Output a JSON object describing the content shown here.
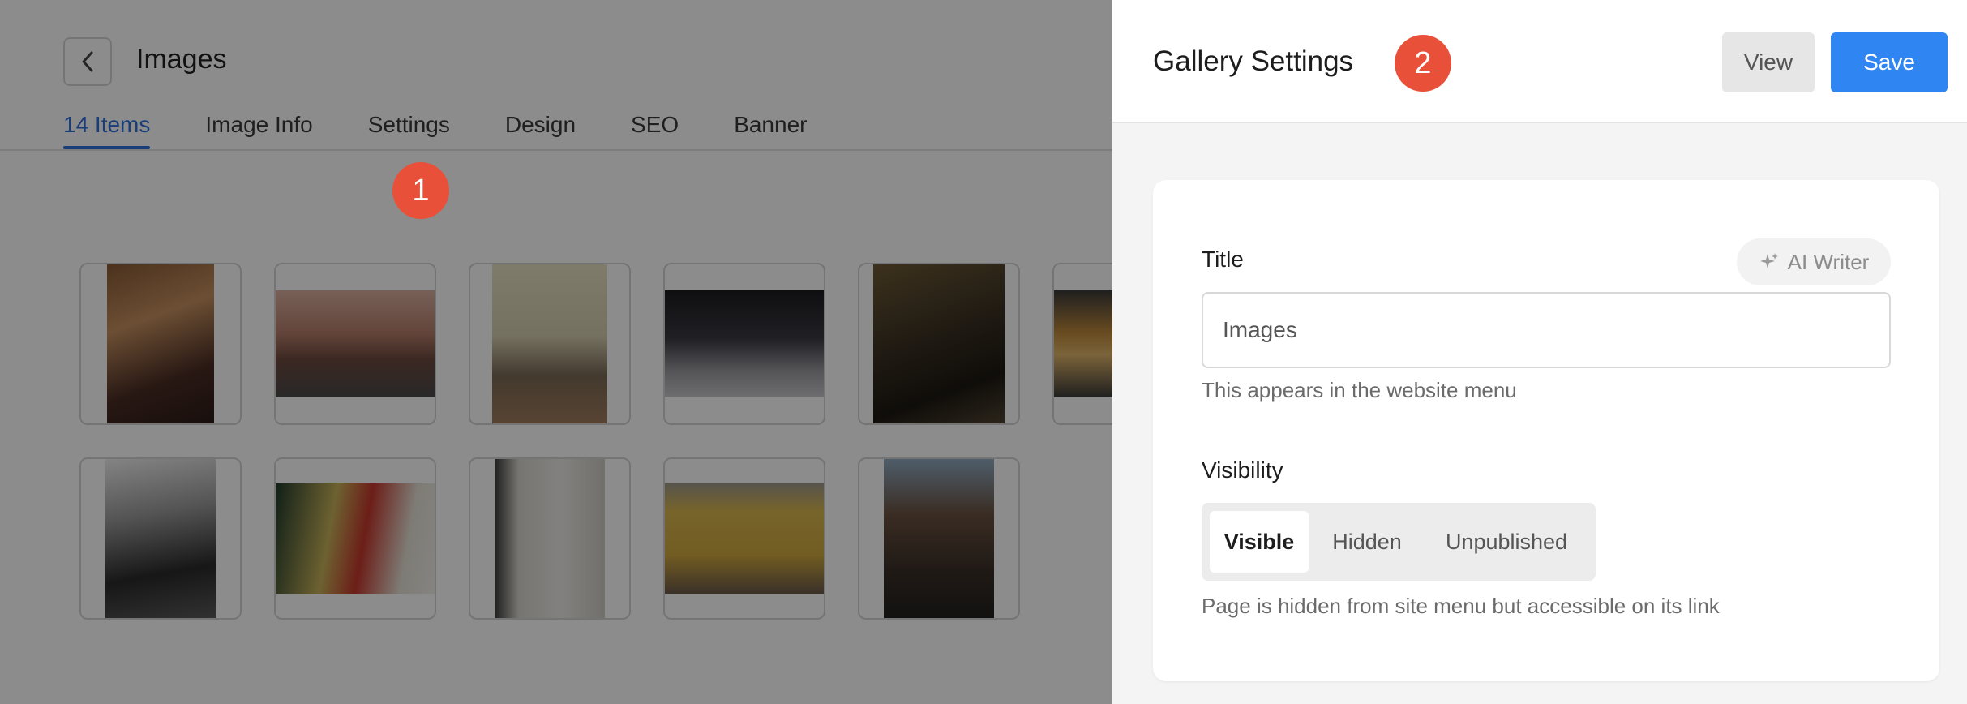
{
  "page": {
    "title": "Images",
    "tabs": [
      {
        "label": "14 Items",
        "active": true
      },
      {
        "label": "Image Info",
        "active": false
      },
      {
        "label": "Settings",
        "active": false
      },
      {
        "label": "Design",
        "active": false
      },
      {
        "label": "SEO",
        "active": false
      },
      {
        "label": "Banner",
        "active": false
      }
    ],
    "markers": [
      "1",
      "2"
    ],
    "thumbnails_count": 12
  },
  "panel": {
    "title": "Gallery Settings",
    "view_label": "View",
    "save_label": "Save",
    "title_field": {
      "label": "Title",
      "ai_writer_label": "AI Writer",
      "value": "Images",
      "help": "This appears in the website menu"
    },
    "visibility": {
      "label": "Visibility",
      "options": [
        "Visible",
        "Hidden",
        "Unpublished"
      ],
      "selected": "Visible",
      "help": "Page is hidden from site menu but accessible on its link"
    }
  },
  "colors": {
    "accent": "#2f6fdc",
    "save_button": "#2f86f2",
    "marker": "#e8503a"
  }
}
